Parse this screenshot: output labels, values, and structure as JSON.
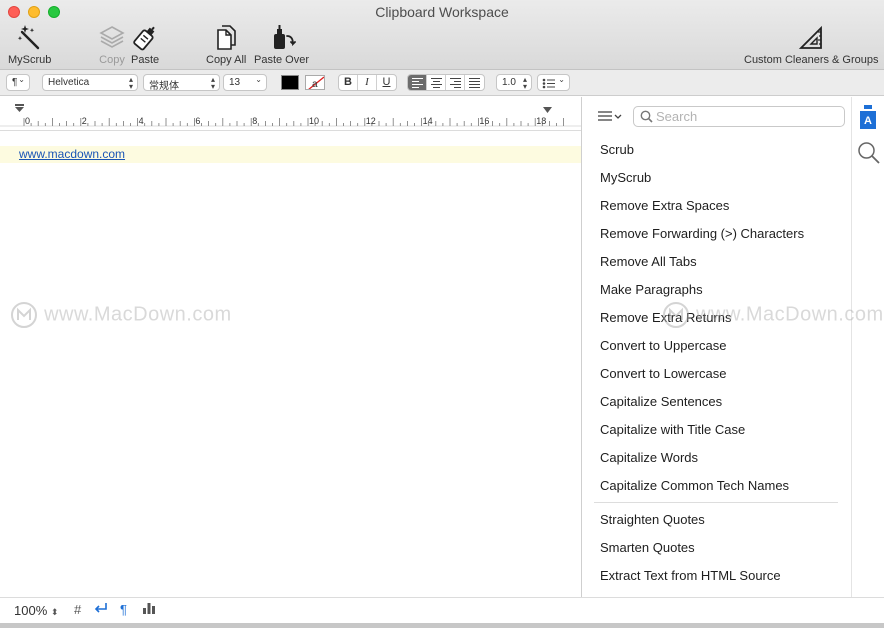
{
  "window": {
    "title": "Clipboard Workspace"
  },
  "toolbar": {
    "myscrub": "MyScrub",
    "copy": "Copy",
    "paste": "Paste",
    "copy_all": "Copy All",
    "paste_over": "Paste Over",
    "custom_cleaners": "Custom Cleaners & Groups"
  },
  "formatbar": {
    "paragraph": "¶",
    "font": "Helvetica",
    "style": "常规体",
    "size": "13",
    "bold": "B",
    "italic": "I",
    "underline": "U",
    "line_spacing": "1.0",
    "text_color": "#000000"
  },
  "ruler": {
    "labels": [
      "0",
      "2",
      "4",
      "6",
      "8",
      "10",
      "12",
      "14",
      "16",
      "18"
    ]
  },
  "document": {
    "link_text": "www.macdown.com"
  },
  "panel": {
    "search_placeholder": "Search",
    "commands_group1": [
      "Scrub",
      "MyScrub",
      "Remove Extra Spaces",
      "Remove Forwarding (>) Characters",
      "Remove All Tabs",
      "Make Paragraphs",
      "Remove Extra Returns",
      "Convert to Uppercase",
      "Convert to Lowercase",
      "Capitalize Sentences",
      "Capitalize with Title Case",
      "Capitalize Words",
      "Capitalize Common Tech Names"
    ],
    "commands_group2": [
      "Straighten Quotes",
      "Smarten Quotes",
      "Extract Text from HTML Source"
    ]
  },
  "statusbar": {
    "zoom": "100%",
    "hash": "#",
    "pilcrow": "¶"
  },
  "watermark": {
    "text": "www.MacDown.com"
  },
  "colors": {
    "link": "#1a55b5",
    "highlight_line": "#fdfbe0",
    "accent": "#1d6fd6"
  }
}
